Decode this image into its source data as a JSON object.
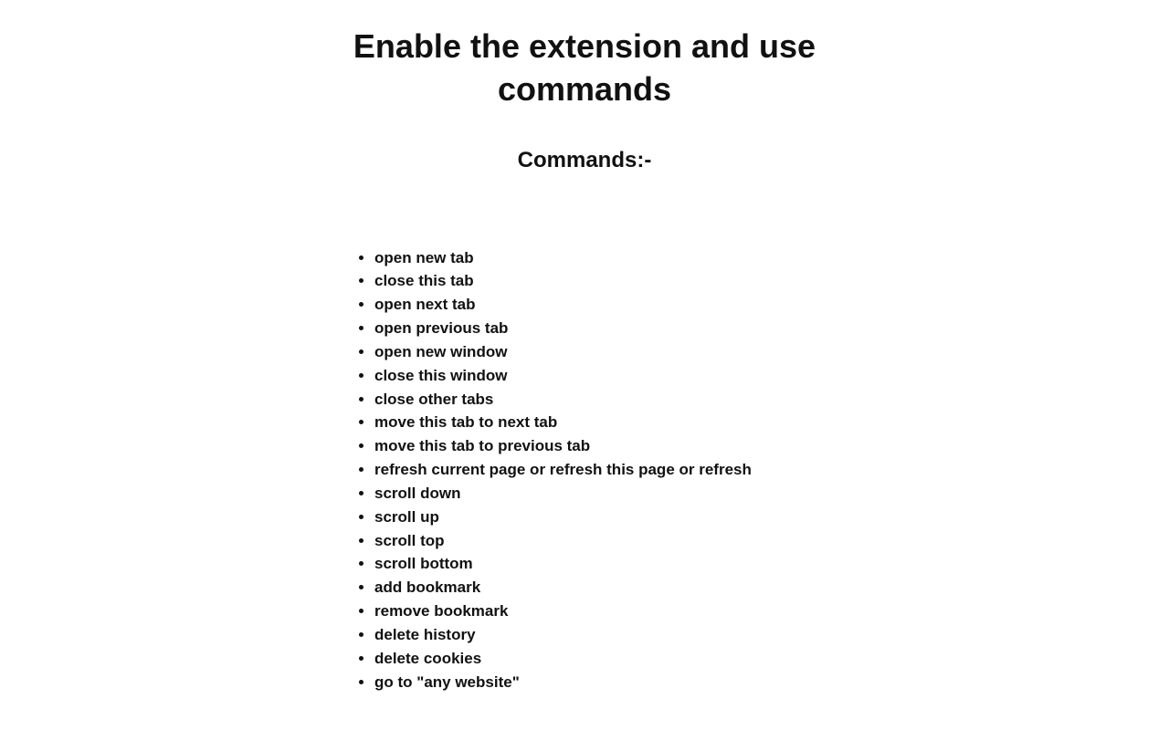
{
  "title": "Enable the extension and use commands",
  "heading": "Commands:-",
  "commands": [
    "open new tab",
    "close this tab",
    "open next tab",
    "open previous tab",
    "open new window",
    "close this window",
    "close other tabs",
    "move this tab to next tab",
    "move this tab to previous tab",
    "refresh current page or refresh this page or refresh",
    "scroll down",
    "scroll up",
    "scroll top",
    "scroll bottom",
    "add bookmark",
    "remove bookmark",
    "delete history",
    "delete cookies",
    "go to \"any website\""
  ]
}
